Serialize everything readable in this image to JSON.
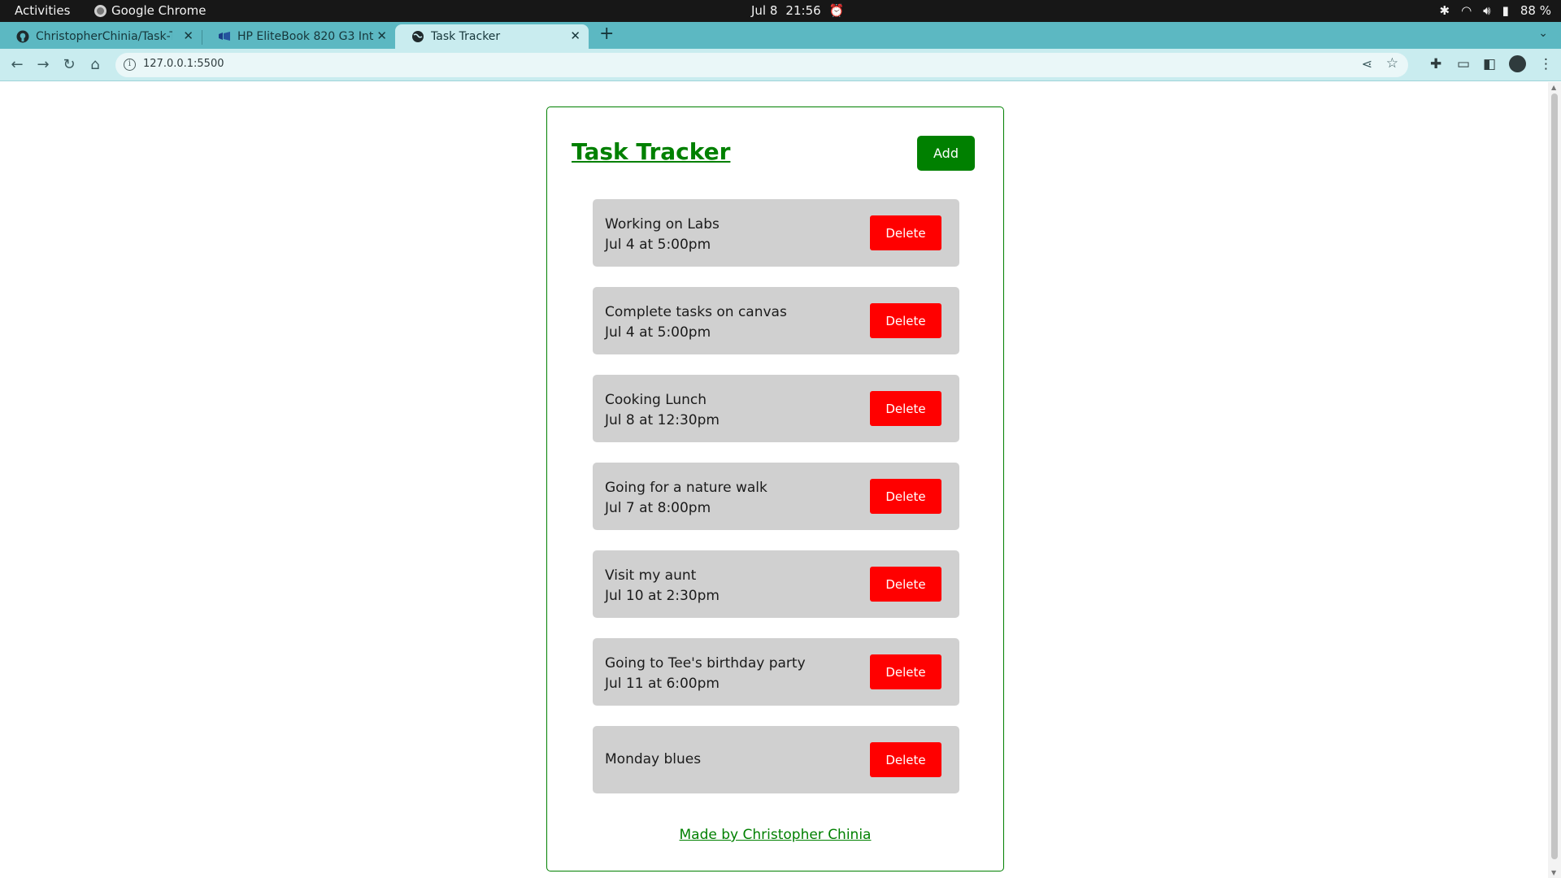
{
  "system_bar": {
    "activities": "Activities",
    "app_name": "Google Chrome",
    "date": "Jul 8",
    "time": "21:56",
    "battery": "88 %"
  },
  "tabs": [
    {
      "title": "ChristopherChinia/Task-T",
      "icon": "github-icon",
      "active": false
    },
    {
      "title": "HP EliteBook 820 G3 Intel",
      "icon": "store-icon",
      "active": false
    },
    {
      "title": "Task Tracker",
      "icon": "globe-icon",
      "active": true
    }
  ],
  "address_bar": {
    "url": "127.0.0.1:5500"
  },
  "app": {
    "title": "Task Tracker",
    "add_label": "Add",
    "delete_label": "Delete",
    "footer": "Made by Christopher Chinia",
    "tasks": [
      {
        "text": "Working on Labs",
        "day": "Jul 4 at 5:00pm"
      },
      {
        "text": "Complete tasks on canvas",
        "day": "Jul 4 at 5:00pm"
      },
      {
        "text": "Cooking Lunch",
        "day": "Jul 8 at 12:30pm"
      },
      {
        "text": "Going for a nature walk",
        "day": "Jul 7 at 8:00pm"
      },
      {
        "text": "Visit my aunt",
        "day": "Jul 10 at 2:30pm"
      },
      {
        "text": "Going to Tee's birthday party",
        "day": "Jul 11 at 6:00pm"
      },
      {
        "text": "Monday blues",
        "day": ""
      }
    ]
  },
  "colors": {
    "accent_green": "#008000",
    "delete_red": "#ff0000",
    "task_bg": "#d0d0d0",
    "tabstrip": "#5cb8c2"
  }
}
